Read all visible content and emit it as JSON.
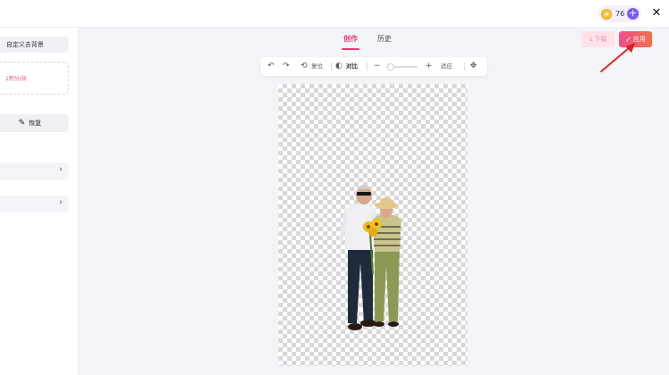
{
  "header": {
    "credits": "76",
    "add_credits": "+",
    "close": "✕"
  },
  "sidebar": {
    "mode_label": "自定义去背景",
    "upload_text": "1积分/张",
    "restore_label": "恢复",
    "rows": [
      "",
      ""
    ]
  },
  "tabs": [
    {
      "label": "创作",
      "active": true
    },
    {
      "label": "历史",
      "active": false
    }
  ],
  "actions": {
    "download_label": "下载",
    "apply_label": "应用"
  },
  "toolbar": {
    "reset_label": "复位",
    "compare_label": "对比",
    "fit_label": "适应",
    "zoom_level": 0.15
  },
  "colors": {
    "accent": "#e43a6a",
    "apply_gradient_start": "#ee4f8e",
    "apply_gradient_end": "#f27049",
    "arrow": "#e0201d"
  }
}
